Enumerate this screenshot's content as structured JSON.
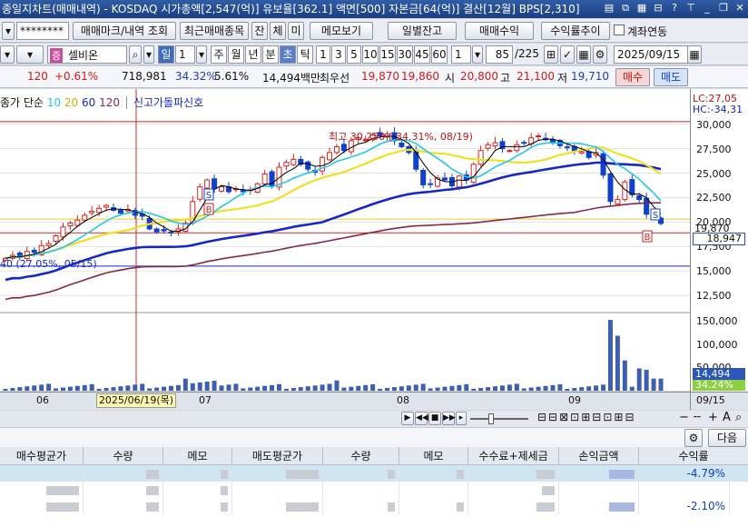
{
  "titlebar": {
    "title": "종일지차트(매매내역) - KOSDAQ 시가총액[2,547(억)] 유보율[362.1] 액면[500] 자본금[64(억)] 결산[12월] BPS[2,310]"
  },
  "toolbar1": {
    "account": "********",
    "trade_mark_btn": "매매마크/내역 조회",
    "recent_trades_btn": "최근매매종목",
    "bal_btn": "잔",
    "exec_btn": "체",
    "not_btn": "미",
    "memo_btn": "메모보기",
    "daily_bal_btn": "일별잔고",
    "trade_profit_btn": "매매수익",
    "yield_trend_btn": "수익률추이",
    "account_link_label": "계좌연동"
  },
  "toolbar2": {
    "stock_badge": "증",
    "stock_name": "셀비온",
    "period_sel": "일",
    "period_num": "1",
    "periods": [
      "주",
      "월",
      "년",
      "분",
      "초",
      "틱"
    ],
    "minute_opts": [
      "1",
      "3",
      "5",
      "10",
      "15",
      "30",
      "45",
      "60"
    ],
    "n_value": "1",
    "count_value": "85",
    "count_total": "/225",
    "date_value": "2025/09/15"
  },
  "quote": {
    "change": "120",
    "change_pct": "+0.61%",
    "volume": "718,981",
    "turnover_pct": "34.32%",
    "ratio_pct": "5.61%",
    "amount": "14,494백만",
    "best_sell_label": "최우선",
    "ask": "19,870",
    "bid": "19,860",
    "open_label": "시",
    "open": "20,800",
    "high_label": "고",
    "high": "21,100",
    "low_label": "저",
    "low": "19,710",
    "buy_btn": "매수",
    "sell_btn": "매도"
  },
  "chart_legend": {
    "prefix": "종가 단순",
    "ma": [
      "5",
      "10",
      "20",
      "60",
      "120"
    ],
    "signal_label": "신고가돌파신호"
  },
  "chart_annotations": {
    "high_note": "최고 30,250 (-34.31%, 08/19)",
    "low_note": "40 (27.05%, 05/15)",
    "lc": "LC:27,05",
    "hc": "HC:-34,31",
    "price_box_1": "19,870",
    "price_box_2": "18,947",
    "vol_box_1": "14,494",
    "vol_box_2": "34.24%"
  },
  "chart_data": [
    {
      "type": "candlestick",
      "title": "",
      "y_ticks": [
        "30,000",
        "27,500",
        "25,000",
        "22,500",
        "20,000",
        "17,500",
        "15,000",
        "12,500"
      ],
      "ylim": [
        11500,
        30800
      ],
      "x_ticks": [
        "06",
        "07",
        "08",
        "09"
      ],
      "cursor_label": "2025/06/19(목)",
      "last_date": "09/15",
      "close_series": [
        16300,
        16600,
        16400,
        17000,
        16900,
        17600,
        17800,
        18600,
        19500,
        19900,
        20200,
        20700,
        21100,
        21400,
        21700,
        21200,
        20900,
        21300,
        20700,
        20600,
        19300,
        19000,
        19100,
        18900,
        19300,
        19900,
        22100,
        23600,
        24300,
        23400,
        23600,
        23100,
        23400,
        23100,
        23300,
        23900,
        24900,
        23700,
        25600,
        26100,
        26400,
        25900,
        25400,
        25100,
        26600,
        27100,
        27700,
        27300,
        28300,
        28600,
        28400,
        28900,
        28800,
        29000,
        28300,
        27700,
        27100,
        25400,
        23800,
        23900,
        24500,
        24300,
        23700,
        24700,
        24300,
        25900,
        27300,
        27900,
        28100,
        27500,
        27300,
        27900,
        28100,
        28600,
        28800,
        28400,
        28100,
        27800,
        27600,
        27300,
        27200,
        26600,
        27100,
        24800,
        22100,
        22300,
        24100,
        22800,
        22300,
        20800,
        20400,
        19860
      ],
      "ma_colors": {
        "5": "#000000",
        "10": "#22c8e8",
        "20": "#f0e020",
        "60": "#1428c8",
        "120": "#882844"
      }
    },
    {
      "type": "bar",
      "title": "volume",
      "y_ticks": [
        "150,000",
        "100,000",
        "50,000"
      ],
      "ylim": [
        0,
        160000
      ]
    }
  ],
  "controls": {
    "zoom_minus": "−",
    "zoom_plus": "+",
    "text_tool": "A",
    "search_icon": "search-icon"
  },
  "bottom_toolbar": {
    "next_btn": "다음"
  },
  "trade_table": {
    "headers": [
      "매수평균가",
      "수량",
      "메모",
      "매도평균가",
      "수량",
      "메모",
      "수수료+제세금",
      "손익금액",
      "수익률"
    ],
    "rows": [
      {
        "rate": "-4.79%",
        "selected": true
      },
      {
        "rate": "",
        "selected": false
      },
      {
        "rate": "-2.10%",
        "selected": false
      }
    ]
  }
}
